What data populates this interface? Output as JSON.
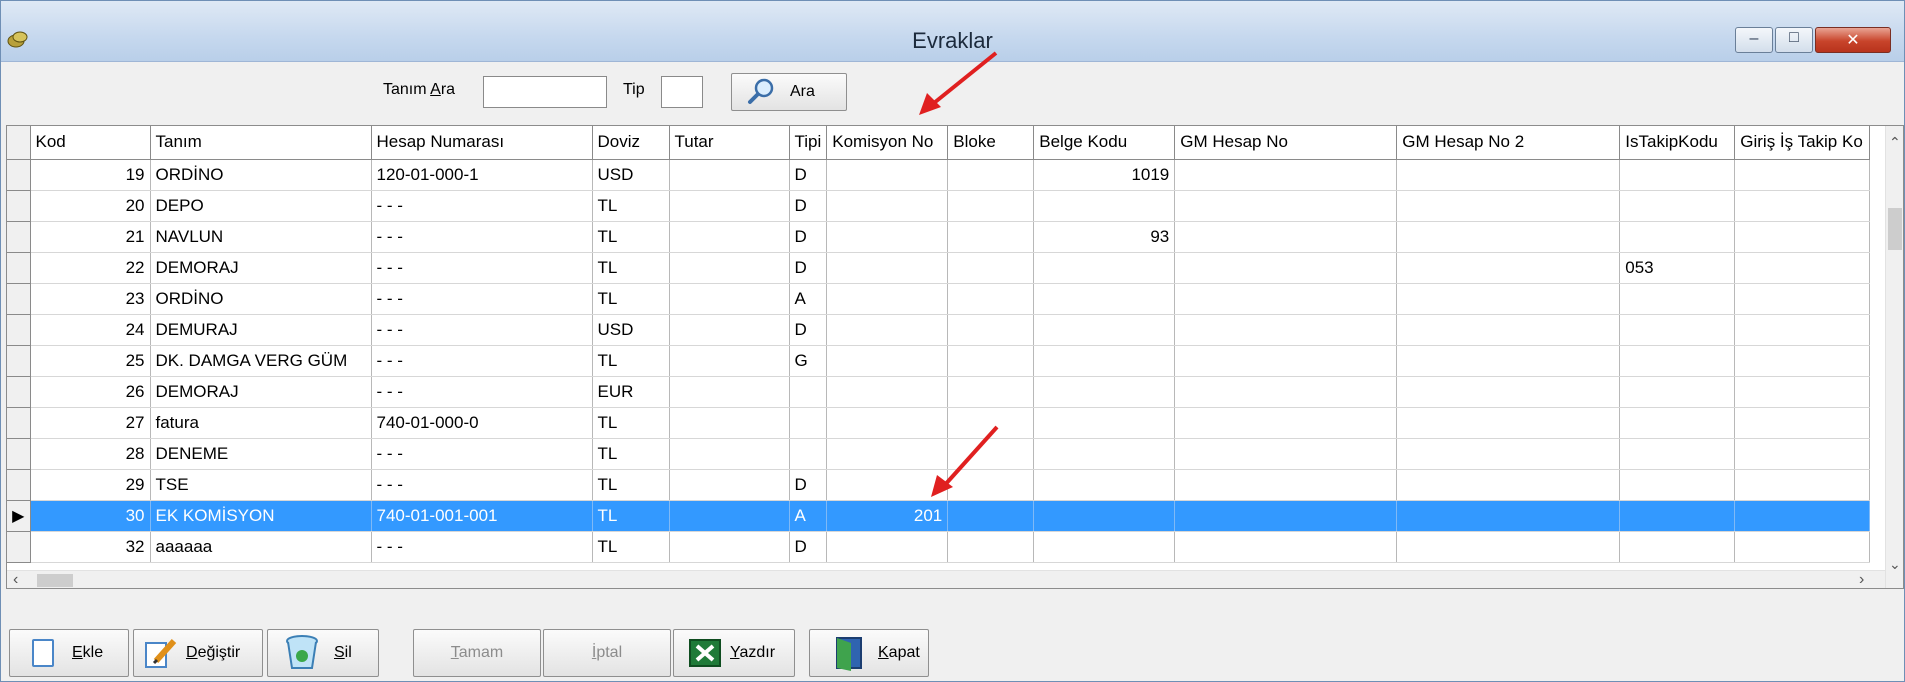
{
  "window": {
    "title": "Evraklar",
    "controls": {
      "minimize": "–",
      "maximize": "□",
      "close": "✕"
    }
  },
  "search": {
    "tanim_prefix": "Tanım ",
    "tanim_underlined": "A",
    "tanim_suffix": "ra",
    "tanim_value": "",
    "tip_label": "Tip",
    "tip_value": "",
    "ara_button": "Ara"
  },
  "grid": {
    "columns": [
      "Kod",
      "Tanım",
      "Hesap Numarası",
      "Doviz",
      "Tutar",
      "Tipi",
      "Komisyon No",
      "Bloke",
      "Belge Kodu",
      "GM Hesap No",
      "GM Hesap No 2",
      "IsTakipKodu",
      "Giriş İş Takip Ko"
    ],
    "rows": [
      {
        "kod": "19",
        "tanim": "ORDİNO",
        "hesap": "120-01-000-1",
        "doviz": "USD",
        "tutar": "",
        "tipi": "D",
        "komisyon": "",
        "bloke": "",
        "belge": "1019",
        "gm": "",
        "gm2": "",
        "istakip": "",
        "giris": ""
      },
      {
        "kod": "20",
        "tanim": "DEPO",
        "hesap": " - - -",
        "doviz": "TL",
        "tutar": "",
        "tipi": "D",
        "komisyon": "",
        "bloke": "",
        "belge": "",
        "gm": "",
        "gm2": "",
        "istakip": "",
        "giris": ""
      },
      {
        "kod": "21",
        "tanim": "NAVLUN",
        "hesap": " - - -",
        "doviz": "TL",
        "tutar": "",
        "tipi": "D",
        "komisyon": "",
        "bloke": "",
        "belge": "93",
        "gm": "",
        "gm2": "",
        "istakip": "",
        "giris": ""
      },
      {
        "kod": "22",
        "tanim": "DEMORAJ",
        "hesap": " - - -",
        "doviz": "TL",
        "tutar": "",
        "tipi": "D",
        "komisyon": "",
        "bloke": "",
        "belge": "",
        "gm": "",
        "gm2": "",
        "istakip": "053",
        "giris": ""
      },
      {
        "kod": "23",
        "tanim": "ORDİNO",
        "hesap": " - - -",
        "doviz": "TL",
        "tutar": "",
        "tipi": "A",
        "komisyon": "",
        "bloke": "",
        "belge": "",
        "gm": "",
        "gm2": "",
        "istakip": "",
        "giris": ""
      },
      {
        "kod": "24",
        "tanim": "DEMURAJ",
        "hesap": " - - -",
        "doviz": "USD",
        "tutar": "",
        "tipi": "D",
        "komisyon": "",
        "bloke": "",
        "belge": "",
        "gm": "",
        "gm2": "",
        "istakip": "",
        "giris": ""
      },
      {
        "kod": "25",
        "tanim": "DK. DAMGA VERG GÜM",
        "hesap": " - - -",
        "doviz": "TL",
        "tutar": "",
        "tipi": "G",
        "komisyon": "",
        "bloke": "",
        "belge": "",
        "gm": "",
        "gm2": "",
        "istakip": "",
        "giris": ""
      },
      {
        "kod": "26",
        "tanim": "DEMORAJ",
        "hesap": " - - -",
        "doviz": "EUR",
        "tutar": "",
        "tipi": "",
        "komisyon": "",
        "bloke": "",
        "belge": "",
        "gm": "",
        "gm2": "",
        "istakip": "",
        "giris": ""
      },
      {
        "kod": "27",
        "tanim": "fatura",
        "hesap": "740-01-000-0",
        "doviz": "TL",
        "tutar": "",
        "tipi": "",
        "komisyon": "",
        "bloke": "",
        "belge": "",
        "gm": "",
        "gm2": "",
        "istakip": "",
        "giris": ""
      },
      {
        "kod": "28",
        "tanim": "DENEME",
        "hesap": " - - -",
        "doviz": "TL",
        "tutar": "",
        "tipi": "",
        "komisyon": "",
        "bloke": "",
        "belge": "",
        "gm": "",
        "gm2": "",
        "istakip": "",
        "giris": ""
      },
      {
        "kod": "29",
        "tanim": "TSE",
        "hesap": " - - -",
        "doviz": "TL",
        "tutar": "",
        "tipi": "D",
        "komisyon": "",
        "bloke": "",
        "belge": "",
        "gm": "",
        "gm2": "",
        "istakip": "",
        "giris": ""
      },
      {
        "kod": "30",
        "tanim": "EK KOMİSYON",
        "hesap": "740-01-001-001",
        "doviz": "TL",
        "tutar": "",
        "tipi": "A",
        "komisyon": "201",
        "bloke": "",
        "belge": "",
        "gm": "",
        "gm2": "",
        "istakip": "",
        "giris": ""
      },
      {
        "kod": "32",
        "tanim": "aaaaaa",
        "hesap": " - - -",
        "doviz": "TL",
        "tutar": "",
        "tipi": "D",
        "komisyon": "",
        "bloke": "",
        "belge": "",
        "gm": "",
        "gm2": "",
        "istakip": "",
        "giris": ""
      }
    ],
    "selected_row_index": 11,
    "current_row_marker": "▶",
    "selection_color": "#3399ff"
  },
  "buttons": {
    "ekle": {
      "underlined": "E",
      "rest": "kle"
    },
    "degistir": {
      "underlined": "D",
      "rest": "eğiştir"
    },
    "sil": {
      "underlined": "S",
      "rest": "il"
    },
    "tamam": {
      "underlined": "T",
      "rest": "amam"
    },
    "iptal": {
      "underlined": "İ",
      "rest": "ptal"
    },
    "yazdir": {
      "underlined": "Y",
      "rest": "azdır"
    },
    "kapat": {
      "underlined": "K",
      "rest": "apat"
    }
  },
  "annotations": {
    "arrow_color": "#e02020"
  },
  "icons": {
    "app": "coin-stack-icon",
    "search": "magnifier-icon",
    "add": "new-document-icon",
    "edit": "pencil-icon",
    "delete": "recycle-bin-icon",
    "print": "excel-icon",
    "close": "exit-door-icon"
  }
}
